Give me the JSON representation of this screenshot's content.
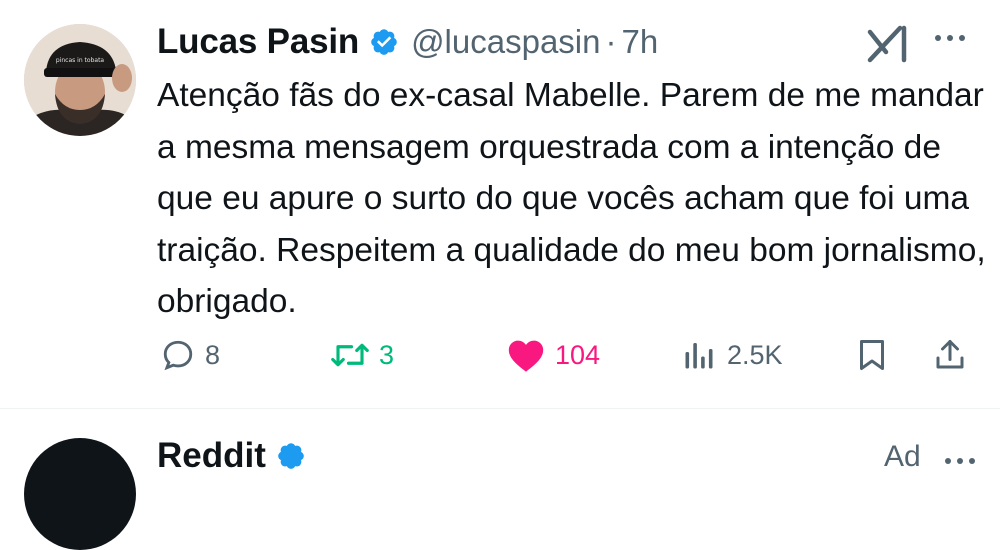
{
  "tweet": {
    "author_name": "Lucas Pasin",
    "handle": "@lucaspasin",
    "separator": "·",
    "time": "7h",
    "avatar_cap_text": "pincas in tobata",
    "text": "Atenção fãs do ex-casal Mabelle. Parem de me mandar a mesma mensagem orquestrada com a intenção de que eu apure o surto do que vocês acham que foi uma traição. Respeitem a qualidade do meu bom jornalismo, obrigado.",
    "actions": {
      "replies": "8",
      "retweets": "3",
      "likes": "104",
      "views": "2.5K"
    }
  },
  "next_tweet": {
    "author_name": "Reddit",
    "ad_label": "Ad"
  },
  "colors": {
    "verified": "#1d9bf0",
    "retweet": "#00ba7c",
    "like": "#f91880",
    "muted": "#536471",
    "text": "#0f1419"
  },
  "icons": [
    "verified-badge-icon",
    "grok-icon",
    "more-icon",
    "reply-icon",
    "retweet-icon",
    "heart-icon",
    "views-icon",
    "bookmark-icon",
    "share-icon"
  ]
}
